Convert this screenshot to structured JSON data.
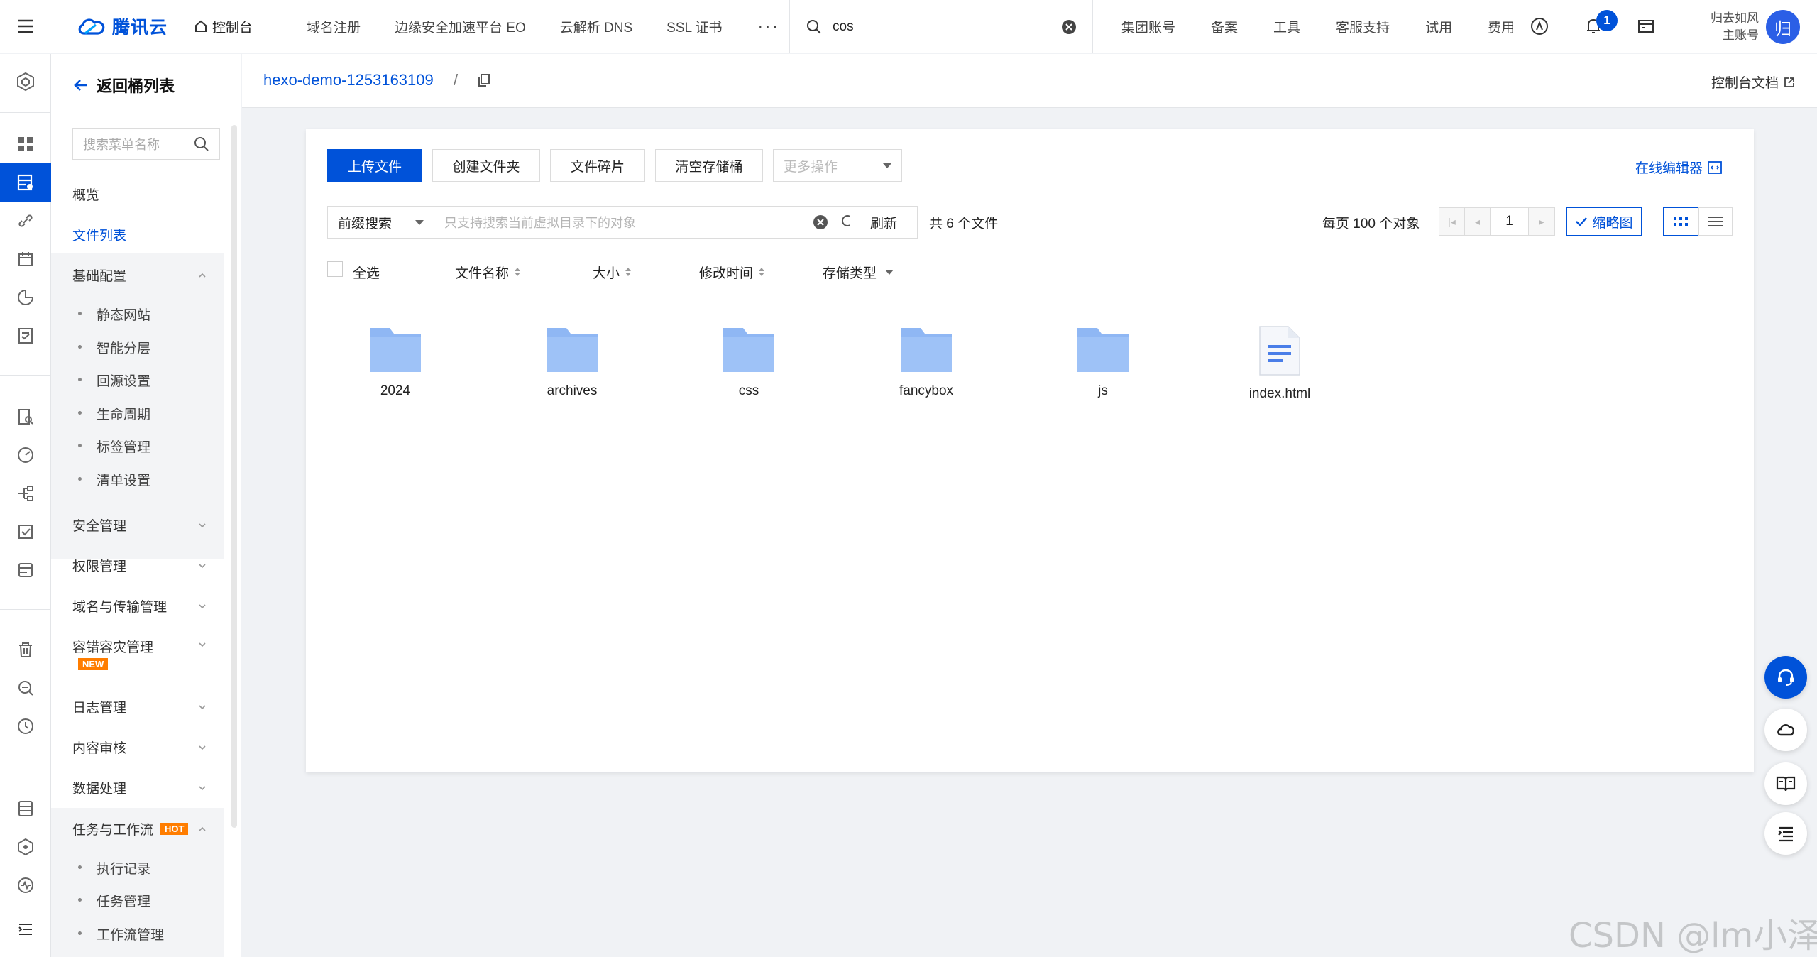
{
  "topnav": {
    "brand": "腾讯云",
    "console": "控制台",
    "links": [
      "域名注册",
      "边缘安全加速平台 EO",
      "云解析 DNS",
      "SSL 证书"
    ],
    "more": "···",
    "search_value": "cos",
    "right_links": [
      "集团账号",
      "备案",
      "工具",
      "客服支持",
      "试用",
      "费用"
    ],
    "notification_count": "1",
    "user_name": "归去如风",
    "user_role": "主账号",
    "avatar_char": "归"
  },
  "menu": {
    "back": "返回桶列表",
    "search_placeholder": "搜索菜单名称",
    "overview": "概览",
    "file_list": "文件列表",
    "basic_config": "基础配置",
    "basic_items": [
      "静态网站",
      "智能分层",
      "回源设置",
      "生命周期",
      "标签管理",
      "清单设置"
    ],
    "security": "安全管理",
    "permission": "权限管理",
    "domain": "域名与传输管理",
    "disaster": "容错容灾管理",
    "new_tag": "NEW",
    "log": "日志管理",
    "audit": "内容审核",
    "data": "数据处理",
    "workflow": "任务与工作流",
    "hot_tag": "HOT",
    "workflow_items": [
      "执行记录",
      "任务管理",
      "工作流管理"
    ]
  },
  "breadcrumb": {
    "bucket": "hexo-demo-1253163109",
    "separator": "/",
    "docs": "控制台文档"
  },
  "toolbar": {
    "upload": "上传文件",
    "create_folder": "创建文件夹",
    "fragments": "文件碎片",
    "clear_bucket": "清空存储桶",
    "more_ops": "更多操作",
    "online_editor": "在线编辑器"
  },
  "filter": {
    "mode": "前缀搜索",
    "placeholder": "只支持搜索当前虚拟目录下的对象",
    "refresh": "刷新",
    "count": "共 6 个文件",
    "per_page": "每页 100 个对象",
    "page": "1",
    "thumbnail": "缩略图"
  },
  "columns": {
    "select_all": "全选",
    "name": "文件名称",
    "size": "大小",
    "modified": "修改时间",
    "storage": "存储类型"
  },
  "files": [
    {
      "name": "2024",
      "type": "folder"
    },
    {
      "name": "archives",
      "type": "folder"
    },
    {
      "name": "css",
      "type": "folder"
    },
    {
      "name": "fancybox",
      "type": "folder"
    },
    {
      "name": "js",
      "type": "folder"
    },
    {
      "name": "index.html",
      "type": "file"
    }
  ],
  "colors": {
    "brand_blue": "#0052d9",
    "folder_blue": "#8fb7f4",
    "tag_orange": "#ff7d00"
  },
  "watermark": "CSDN @lm小泽"
}
